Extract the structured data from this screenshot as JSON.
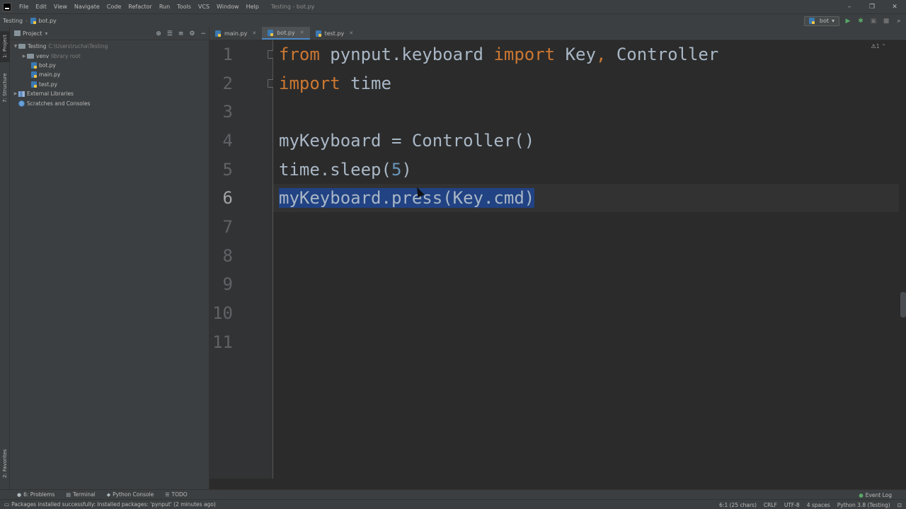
{
  "menu": {
    "items": [
      "File",
      "Edit",
      "View",
      "Navigate",
      "Code",
      "Refactor",
      "Run",
      "Tools",
      "VCS",
      "Window",
      "Help"
    ],
    "window_title": "Testing - bot.py"
  },
  "window_controls": {
    "minimize": "–",
    "restore": "❐",
    "close": "✕"
  },
  "breadcrumb": {
    "project": "Testing",
    "file": "bot.py"
  },
  "run_toolbar": {
    "config": "bot"
  },
  "left_stripe": {
    "project": "1: Project",
    "structure": "7: Structure",
    "favorites": "2: Favorites"
  },
  "project_panel": {
    "title": "Project",
    "tree": {
      "root_name": "Testing",
      "root_path": "C:\\Users\\rucha\\Testing",
      "venv_name": "venv",
      "venv_hint": "library root",
      "files": [
        "bot.py",
        "main.py",
        "test.py"
      ],
      "external_libraries": "External Libraries",
      "scratches": "Scratches and Consoles"
    }
  },
  "editor_tabs": [
    "main.py",
    "bot.py",
    "test.py"
  ],
  "editor": {
    "inspection": "1",
    "line_numbers": [
      "1",
      "2",
      "3",
      "4",
      "5",
      "6",
      "7",
      "8",
      "9",
      "10",
      "11"
    ],
    "current_line": 6,
    "code": {
      "l1_kw1": "from",
      "l1_mod": " pynput.keyboard ",
      "l1_kw2": "import",
      "l1_rest": " Key",
      "l1_comma": ",",
      "l1_end": " Controller",
      "l2_kw": "import",
      "l2_rest": " time",
      "l4": "myKeyboard = Controller()",
      "l5_a": "time.sleep(",
      "l5_num": "5",
      "l5_b": ")",
      "l6": "myKeyboard.press(Key.cmd)"
    }
  },
  "tool_windows": {
    "problems": "6: Problems",
    "terminal": "Terminal",
    "python_console": "Python Console",
    "todo": "TODO",
    "event_log": "Event Log"
  },
  "status_bar": {
    "message": "Packages installed successfully: Installed packages: 'pynput' (2 minutes ago)",
    "position": "6:1 (25 chars)",
    "line_sep": "CRLF",
    "encoding": "UTF-8",
    "indent": "4 spaces",
    "interpreter": "Python 3.8 (Testing)"
  },
  "colors": {
    "keyword": "#cc7832",
    "number": "#6897bb",
    "selection": "#214283",
    "text": "#a9b7c6"
  }
}
